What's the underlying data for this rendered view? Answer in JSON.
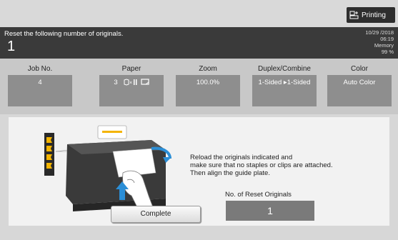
{
  "header": {
    "printing_label": "Printing"
  },
  "message": {
    "text": "Reset the following number of originals.",
    "count": "1",
    "date": "10/29 /2018",
    "time": "06:19",
    "memory_label": "Memory",
    "memory_value": "99 %"
  },
  "job_info": [
    {
      "label": "Job No.",
      "value": "4"
    },
    {
      "label": "Paper",
      "value": "3"
    },
    {
      "label": "Zoom",
      "value": "100.0%"
    },
    {
      "label": "Duplex/Combine",
      "value": "1-Sided ▸1-Sided"
    },
    {
      "label": "Color",
      "value": "Auto Color"
    }
  ],
  "instructions": {
    "line1": "Reload the originals indicated and",
    "line2": "make sure that no staples or clips are attached.",
    "line3": "Then align the guide plate."
  },
  "reset": {
    "label": "No. of Reset Originals",
    "value": "1"
  },
  "complete_label": "Complete",
  "colors": {
    "dark_bar": "#3a3a3a",
    "info_box": "#8e8e8e",
    "panel": "#f2f2f2",
    "accent_blue": "#2b8ed6",
    "accent_yellow": "#f4b400"
  }
}
